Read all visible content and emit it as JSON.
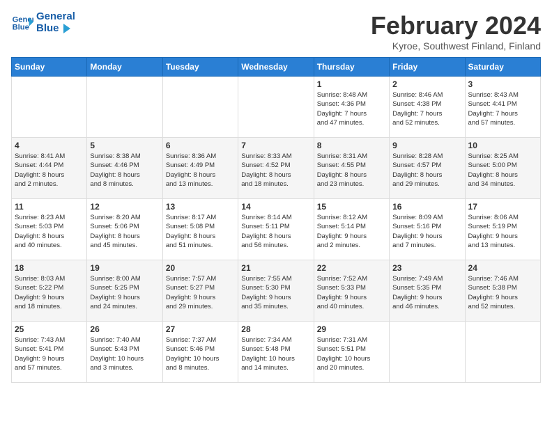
{
  "header": {
    "logo_line1": "General",
    "logo_line2": "Blue",
    "title": "February 2024",
    "subtitle": "Kyroe, Southwest Finland, Finland"
  },
  "weekdays": [
    "Sunday",
    "Monday",
    "Tuesday",
    "Wednesday",
    "Thursday",
    "Friday",
    "Saturday"
  ],
  "weeks": [
    [
      {
        "day": "",
        "info": ""
      },
      {
        "day": "",
        "info": ""
      },
      {
        "day": "",
        "info": ""
      },
      {
        "day": "",
        "info": ""
      },
      {
        "day": "1",
        "info": "Sunrise: 8:48 AM\nSunset: 4:36 PM\nDaylight: 7 hours\nand 47 minutes."
      },
      {
        "day": "2",
        "info": "Sunrise: 8:46 AM\nSunset: 4:38 PM\nDaylight: 7 hours\nand 52 minutes."
      },
      {
        "day": "3",
        "info": "Sunrise: 8:43 AM\nSunset: 4:41 PM\nDaylight: 7 hours\nand 57 minutes."
      }
    ],
    [
      {
        "day": "4",
        "info": "Sunrise: 8:41 AM\nSunset: 4:44 PM\nDaylight: 8 hours\nand 2 minutes."
      },
      {
        "day": "5",
        "info": "Sunrise: 8:38 AM\nSunset: 4:46 PM\nDaylight: 8 hours\nand 8 minutes."
      },
      {
        "day": "6",
        "info": "Sunrise: 8:36 AM\nSunset: 4:49 PM\nDaylight: 8 hours\nand 13 minutes."
      },
      {
        "day": "7",
        "info": "Sunrise: 8:33 AM\nSunset: 4:52 PM\nDaylight: 8 hours\nand 18 minutes."
      },
      {
        "day": "8",
        "info": "Sunrise: 8:31 AM\nSunset: 4:55 PM\nDaylight: 8 hours\nand 23 minutes."
      },
      {
        "day": "9",
        "info": "Sunrise: 8:28 AM\nSunset: 4:57 PM\nDaylight: 8 hours\nand 29 minutes."
      },
      {
        "day": "10",
        "info": "Sunrise: 8:25 AM\nSunset: 5:00 PM\nDaylight: 8 hours\nand 34 minutes."
      }
    ],
    [
      {
        "day": "11",
        "info": "Sunrise: 8:23 AM\nSunset: 5:03 PM\nDaylight: 8 hours\nand 40 minutes."
      },
      {
        "day": "12",
        "info": "Sunrise: 8:20 AM\nSunset: 5:06 PM\nDaylight: 8 hours\nand 45 minutes."
      },
      {
        "day": "13",
        "info": "Sunrise: 8:17 AM\nSunset: 5:08 PM\nDaylight: 8 hours\nand 51 minutes."
      },
      {
        "day": "14",
        "info": "Sunrise: 8:14 AM\nSunset: 5:11 PM\nDaylight: 8 hours\nand 56 minutes."
      },
      {
        "day": "15",
        "info": "Sunrise: 8:12 AM\nSunset: 5:14 PM\nDaylight: 9 hours\nand 2 minutes."
      },
      {
        "day": "16",
        "info": "Sunrise: 8:09 AM\nSunset: 5:16 PM\nDaylight: 9 hours\nand 7 minutes."
      },
      {
        "day": "17",
        "info": "Sunrise: 8:06 AM\nSunset: 5:19 PM\nDaylight: 9 hours\nand 13 minutes."
      }
    ],
    [
      {
        "day": "18",
        "info": "Sunrise: 8:03 AM\nSunset: 5:22 PM\nDaylight: 9 hours\nand 18 minutes."
      },
      {
        "day": "19",
        "info": "Sunrise: 8:00 AM\nSunset: 5:25 PM\nDaylight: 9 hours\nand 24 minutes."
      },
      {
        "day": "20",
        "info": "Sunrise: 7:57 AM\nSunset: 5:27 PM\nDaylight: 9 hours\nand 29 minutes."
      },
      {
        "day": "21",
        "info": "Sunrise: 7:55 AM\nSunset: 5:30 PM\nDaylight: 9 hours\nand 35 minutes."
      },
      {
        "day": "22",
        "info": "Sunrise: 7:52 AM\nSunset: 5:33 PM\nDaylight: 9 hours\nand 40 minutes."
      },
      {
        "day": "23",
        "info": "Sunrise: 7:49 AM\nSunset: 5:35 PM\nDaylight: 9 hours\nand 46 minutes."
      },
      {
        "day": "24",
        "info": "Sunrise: 7:46 AM\nSunset: 5:38 PM\nDaylight: 9 hours\nand 52 minutes."
      }
    ],
    [
      {
        "day": "25",
        "info": "Sunrise: 7:43 AM\nSunset: 5:41 PM\nDaylight: 9 hours\nand 57 minutes."
      },
      {
        "day": "26",
        "info": "Sunrise: 7:40 AM\nSunset: 5:43 PM\nDaylight: 10 hours\nand 3 minutes."
      },
      {
        "day": "27",
        "info": "Sunrise: 7:37 AM\nSunset: 5:46 PM\nDaylight: 10 hours\nand 8 minutes."
      },
      {
        "day": "28",
        "info": "Sunrise: 7:34 AM\nSunset: 5:48 PM\nDaylight: 10 hours\nand 14 minutes."
      },
      {
        "day": "29",
        "info": "Sunrise: 7:31 AM\nSunset: 5:51 PM\nDaylight: 10 hours\nand 20 minutes."
      },
      {
        "day": "",
        "info": ""
      },
      {
        "day": "",
        "info": ""
      }
    ]
  ]
}
